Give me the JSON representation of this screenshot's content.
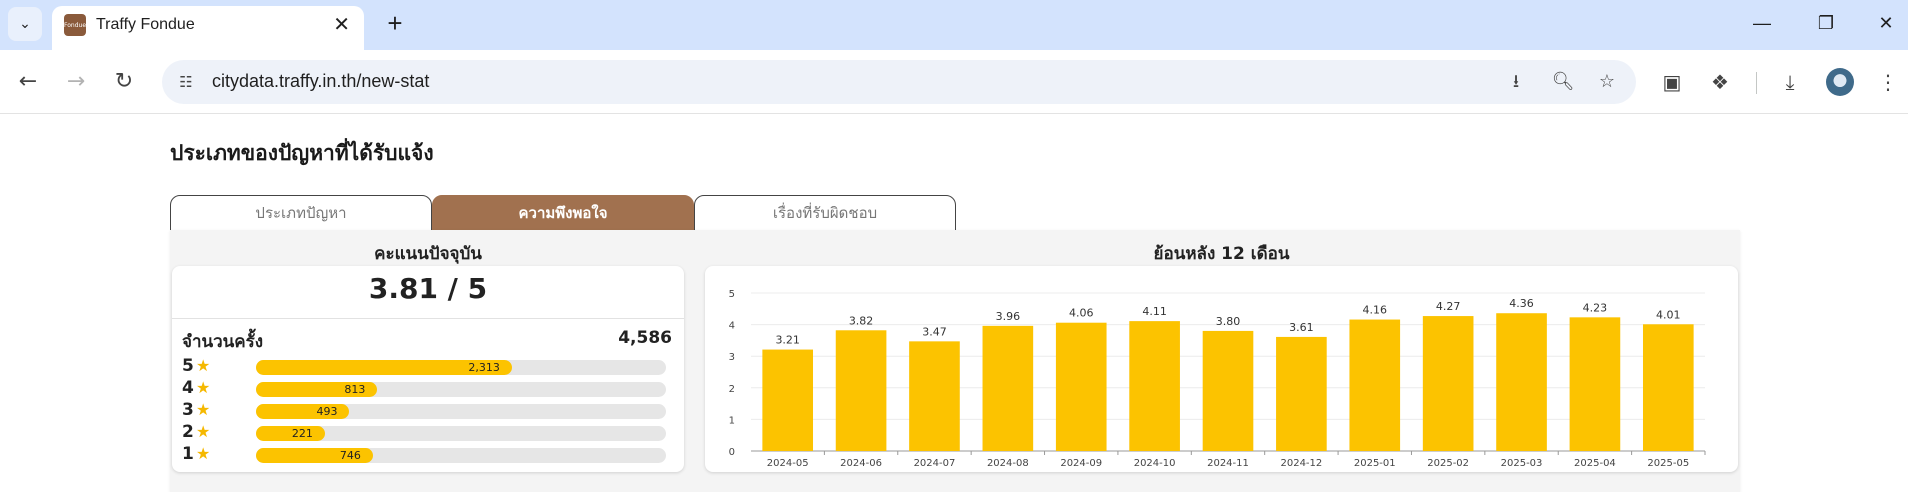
{
  "browser": {
    "tab_title": "Traffy Fondue",
    "tab_favicon_text": "Fondue",
    "url": "citydata.traffy.in.th/new-stat"
  },
  "page": {
    "title": "ประเภทของปัญหาที่ได้รับแจ้ง",
    "tabs": [
      {
        "label": "ประเภทปัญหา",
        "active": false
      },
      {
        "label": "ความพึงพอใจ",
        "active": true
      },
      {
        "label": "เรื่องที่รับผิดชอบ",
        "active": false
      }
    ],
    "current": {
      "heading": "คะแนนปัจจุบัน",
      "score": "3.81 / 5",
      "count_label": "จำนวนครั้ง",
      "count_total": "4,586",
      "ratings": [
        {
          "stars": "5",
          "count": "2,313",
          "fraction": 0.624
        },
        {
          "stars": "4",
          "count": "813",
          "fraction": 0.296
        },
        {
          "stars": "3",
          "count": "493",
          "fraction": 0.228
        },
        {
          "stars": "2",
          "count": "221",
          "fraction": 0.168
        },
        {
          "stars": "1",
          "count": "746",
          "fraction": 0.285
        }
      ]
    },
    "history_heading": "ย้อนหลัง 12 เดือน"
  },
  "chart_data": {
    "type": "bar",
    "title": "ย้อนหลัง 12 เดือน",
    "categories": [
      "2024-05",
      "2024-06",
      "2024-07",
      "2024-08",
      "2024-09",
      "2024-10",
      "2024-11",
      "2024-12",
      "2025-01",
      "2025-02",
      "2025-03",
      "2025-04",
      "2025-05"
    ],
    "values": [
      3.21,
      3.82,
      3.47,
      3.96,
      4.06,
      4.11,
      3.8,
      3.61,
      4.16,
      4.27,
      4.36,
      4.23,
      4.01
    ],
    "labels": [
      "3.21",
      "3.82",
      "3.47",
      "3.96",
      "4.06",
      "4.11",
      "3.80",
      "3.61",
      "4.16",
      "4.27",
      "4.36",
      "4.23",
      "4.01"
    ],
    "ylim": [
      0,
      5
    ],
    "yticks": [
      0,
      1,
      2,
      3,
      4,
      5
    ],
    "grid": true,
    "bar_color": "#fcc300"
  },
  "colors": {
    "accent_brown": "#a1714f",
    "bar_yellow": "#fcc300",
    "star_yellow": "#f5b800"
  }
}
